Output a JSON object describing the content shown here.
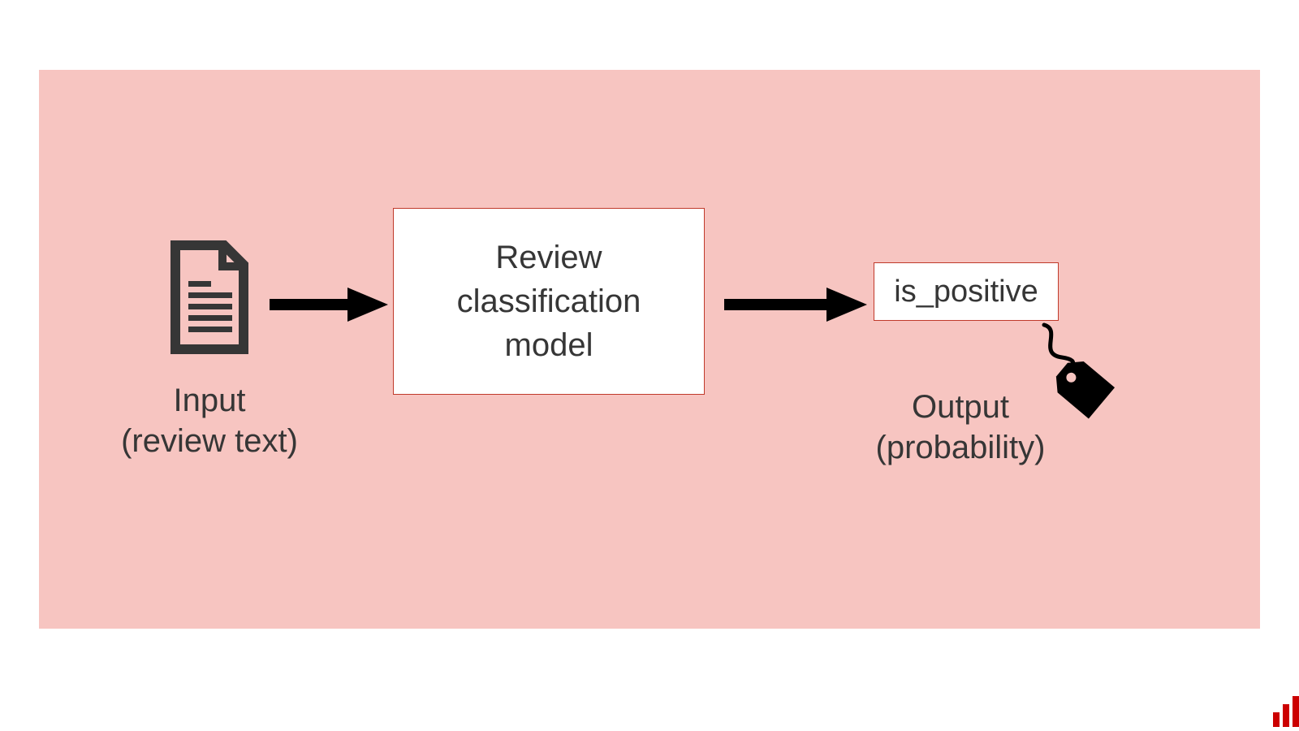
{
  "diagram": {
    "input": {
      "icon": "document",
      "label_line1": "Input",
      "label_line2": "(review text)"
    },
    "model": {
      "label_line1": "Review",
      "label_line2": "classification",
      "label_line3": "model"
    },
    "output": {
      "value": "is_positive",
      "icon": "tag",
      "label_line1": "Output",
      "label_line2": "(probability)"
    },
    "arrows": [
      "input→model",
      "model→output"
    ]
  },
  "colors": {
    "background": "#f7c5c1",
    "box_border": "#c03a2b",
    "text": "#363636",
    "icon_dark": "#363636",
    "accent": "#cc0000"
  }
}
